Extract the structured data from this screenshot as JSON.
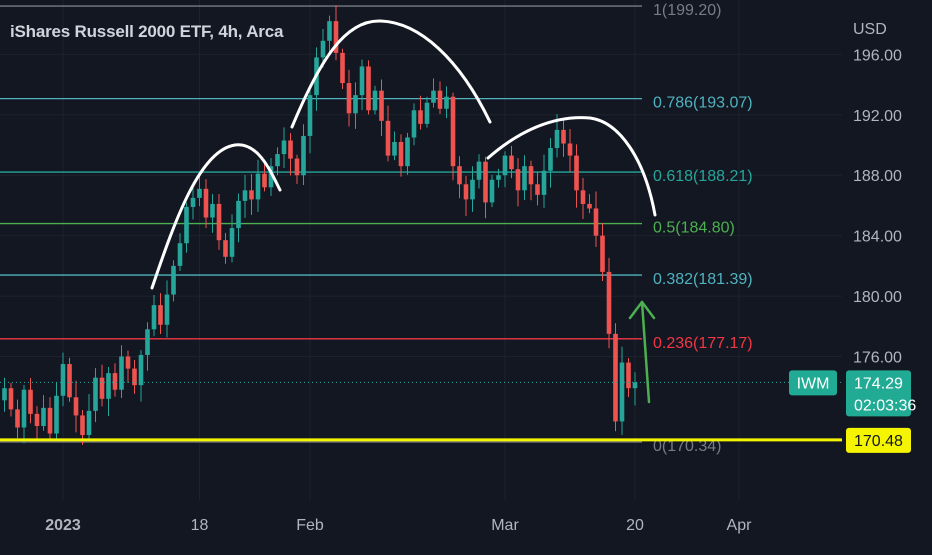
{
  "chart_data": {
    "type": "candlestick",
    "title": "iShares Russell 2000 ETF, 4h, Arca",
    "currency": "USD",
    "ylim": [
      166.5,
      199.6
    ],
    "y_ticks": [
      "196.00",
      "192.00",
      "188.00",
      "184.00",
      "180.00",
      "176.00"
    ],
    "y_tick_values": [
      196,
      192,
      188,
      184,
      180,
      176
    ],
    "x_tick_labels": [
      "2023",
      "18",
      "Feb",
      "Mar",
      "20",
      "Apr"
    ],
    "x_tick_bars": [
      9,
      30,
      47,
      77,
      97,
      113
    ],
    "last_price": {
      "ticker": "IWM",
      "price": "174.29",
      "countdown": "02:03:36",
      "value": 174.29
    },
    "horizontal_line": {
      "label": "170.48",
      "value": 170.48
    },
    "fib_levels": [
      {
        "label": "1(199.20)",
        "value": 199.2,
        "color": "#787b86"
      },
      {
        "label": "0.786(193.07)",
        "value": 193.07,
        "color": "#4fb3bf"
      },
      {
        "label": "0.618(188.21)",
        "value": 188.21,
        "color": "#26a69a"
      },
      {
        "label": "0.5(184.80)",
        "value": 184.8,
        "color": "#4caf50"
      },
      {
        "label": "0.382(181.39)",
        "value": 181.39,
        "color": "#4fb3bf"
      },
      {
        "label": "0.236(177.17)",
        "value": 177.17,
        "color": "#f23645"
      },
      {
        "label": "0(170.34)",
        "value": 170.34,
        "color": "#787b86"
      }
    ],
    "closes": [
      173.9,
      172.5,
      171.3,
      173.8,
      172.2,
      171.4,
      172.6,
      170.9,
      173.4,
      175.5,
      173.3,
      172.1,
      170.8,
      172.4,
      174.6,
      173.2,
      174.9,
      173.8,
      176.0,
      175.2,
      174.1,
      176.1,
      177.8,
      179.4,
      178.1,
      180.1,
      182.0,
      183.5,
      185.9,
      186.5,
      187.1,
      185.2,
      186.1,
      183.7,
      182.6,
      184.5,
      186.3,
      187.0,
      186.4,
      188.1,
      187.2,
      188.6,
      189.4,
      190.3,
      189.1,
      188.0,
      190.6,
      193.3,
      195.8,
      196.9,
      198.2,
      196.1,
      194.1,
      192.1,
      193.3,
      195.2,
      192.3,
      193.6,
      191.6,
      189.3,
      190.2,
      188.6,
      190.5,
      192.3,
      191.4,
      192.8,
      193.6,
      192.4,
      193.2,
      188.6,
      187.4,
      186.4,
      187.7,
      188.9,
      186.2,
      187.7,
      188.0,
      189.3,
      188.4,
      187.0,
      188.6,
      187.4,
      186.7,
      188.3,
      189.8,
      191.0,
      190.1,
      189.3,
      187.0,
      186.1,
      185.8,
      184.0,
      181.6,
      177.5,
      171.7,
      175.6,
      173.9,
      174.29
    ],
    "overlays": {
      "arcs": "white curved lines tracing head-and-shoulders",
      "arrow": "green upward arrow"
    }
  }
}
